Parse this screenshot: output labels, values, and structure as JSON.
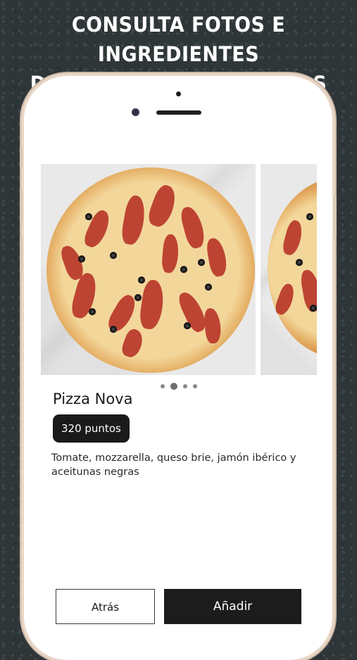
{
  "promo": {
    "headline_line1": "CONSULTA FOTOS E INGREDIENTES",
    "headline_line2": "DE NUESTROS PRODUCTOS"
  },
  "product": {
    "name": "Pizza Nova",
    "points_badge": "320 puntos",
    "description": "Tomate, mozzarella, queso brie, jamón ibérico y aceitunas negras"
  },
  "carousel": {
    "page_count": 4,
    "active_page": 2
  },
  "actions": {
    "back_label": "Atrás",
    "add_label": "Añadir"
  }
}
